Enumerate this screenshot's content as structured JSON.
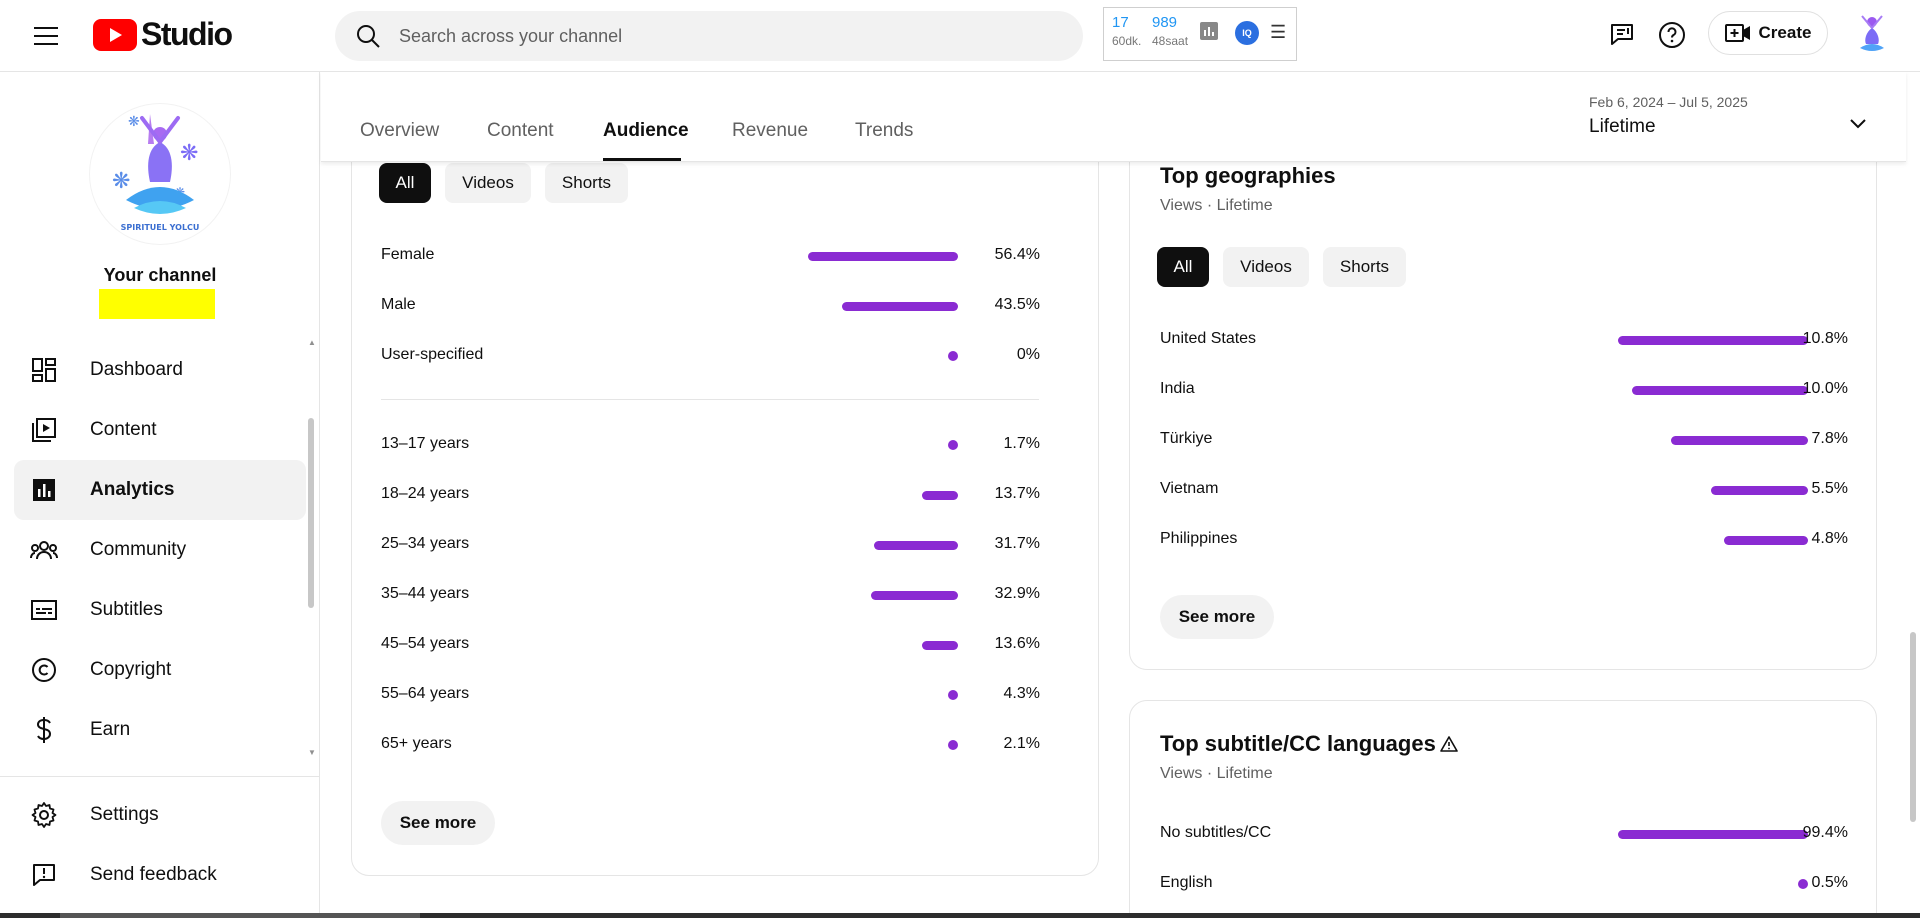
{
  "app": {
    "logo_text": "Studio",
    "search_placeholder": "Search across your channel",
    "create_label": "Create",
    "brand_red": "#ff0000",
    "accent_purple": "#8a2bd2"
  },
  "extension": {
    "count_a": "17",
    "label_a": "60dk.",
    "count_b": "989",
    "label_b": "48saat",
    "badge": "IQ"
  },
  "icons": {
    "menu": "hamburger-icon",
    "search": "search-icon",
    "whats_new": "playlist-add-icon",
    "help": "help-icon",
    "create": "create-video-icon",
    "date_dropdown": "chevron-down-icon"
  },
  "sidebar": {
    "channel_title": "Your channel",
    "avatar_text": "SPIRITUEL YOLCU",
    "items": [
      {
        "label": "Dashboard",
        "icon": "dashboard-icon"
      },
      {
        "label": "Content",
        "icon": "content-icon"
      },
      {
        "label": "Analytics",
        "icon": "analytics-icon",
        "active": true
      },
      {
        "label": "Community",
        "icon": "community-icon"
      },
      {
        "label": "Subtitles",
        "icon": "subtitles-icon"
      },
      {
        "label": "Copyright",
        "icon": "copyright-icon"
      },
      {
        "label": "Earn",
        "icon": "dollar-icon"
      }
    ],
    "bottom_items": [
      {
        "label": "Settings",
        "icon": "gear-icon"
      },
      {
        "label": "Send feedback",
        "icon": "feedback-icon"
      }
    ]
  },
  "tabs": {
    "items": [
      "Overview",
      "Content",
      "Audience",
      "Revenue",
      "Trends"
    ],
    "active": "Audience"
  },
  "date": {
    "range": "Feb 6, 2024 – Jul 5, 2025",
    "label": "Lifetime"
  },
  "demographics": {
    "chips": [
      "All",
      "Videos",
      "Shorts"
    ],
    "active_chip": "All",
    "gender": [
      {
        "label": "Female",
        "value": "56.4%",
        "pct": 56.4
      },
      {
        "label": "Male",
        "value": "43.5%",
        "pct": 43.5
      },
      {
        "label": "User-specified",
        "value": "0%",
        "pct": 0
      }
    ],
    "age": [
      {
        "label": "13–17 years",
        "value": "1.7%",
        "pct": 1.7
      },
      {
        "label": "18–24 years",
        "value": "13.7%",
        "pct": 13.7
      },
      {
        "label": "25–34 years",
        "value": "31.7%",
        "pct": 31.7
      },
      {
        "label": "35–44 years",
        "value": "32.9%",
        "pct": 32.9
      },
      {
        "label": "45–54 years",
        "value": "13.6%",
        "pct": 13.6
      },
      {
        "label": "55–64 years",
        "value": "4.3%",
        "pct": 4.3
      },
      {
        "label": "65+ years",
        "value": "2.1%",
        "pct": 2.1
      }
    ],
    "see_more": "See more"
  },
  "geographies": {
    "title": "Top geographies",
    "subtitle": "Views · Lifetime",
    "chips": [
      "All",
      "Videos",
      "Shorts"
    ],
    "active_chip": "All",
    "rows": [
      {
        "label": "United States",
        "value": "10.8%",
        "pct": 10.8
      },
      {
        "label": "India",
        "value": "10.0%",
        "pct": 10.0
      },
      {
        "label": "Türkiye",
        "value": "7.8%",
        "pct": 7.8
      },
      {
        "label": "Vietnam",
        "value": "5.5%",
        "pct": 5.5
      },
      {
        "label": "Philippines",
        "value": "4.8%",
        "pct": 4.8
      }
    ],
    "see_more": "See more"
  },
  "subtitles": {
    "title": "Top subtitle/CC languages",
    "subtitle": "Views · Lifetime",
    "warning_icon": "warning-icon",
    "rows": [
      {
        "label": "No subtitles/CC",
        "value": "99.4%",
        "pct": 99.4
      },
      {
        "label": "English",
        "value": "0.5%",
        "pct": 0.5
      }
    ]
  }
}
